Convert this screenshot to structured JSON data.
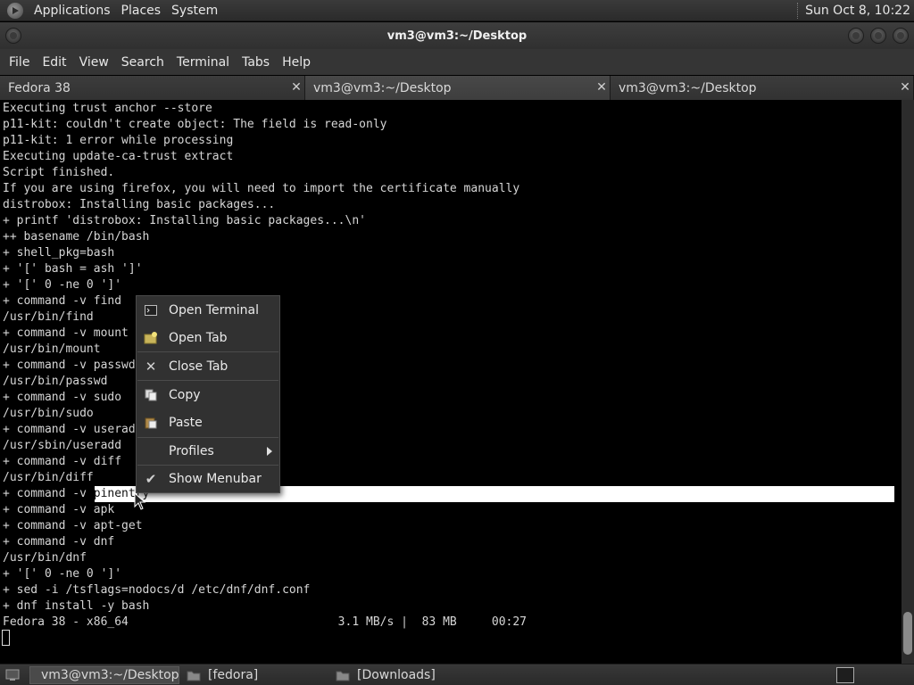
{
  "top_panel": {
    "menus": [
      "Applications",
      "Places",
      "System"
    ],
    "clock": "Sun Oct  8, 10:22"
  },
  "window": {
    "title": "vm3@vm3:~/Desktop"
  },
  "menubar": {
    "items": [
      "File",
      "Edit",
      "View",
      "Search",
      "Terminal",
      "Tabs",
      "Help"
    ]
  },
  "tabs": [
    {
      "label": "Fedora 38",
      "active": false
    },
    {
      "label": "vm3@vm3:~/Desktop",
      "active": true
    },
    {
      "label": "vm3@vm3:~/Desktop",
      "active": false
    }
  ],
  "terminal": {
    "lines": [
      "Executing trust anchor --store",
      "p11-kit: couldn't create object: The field is read-only",
      "p11-kit: 1 error while processing",
      "Executing update-ca-trust extract",
      "Script finished.",
      "If you are using firefox, you will need to import the certificate manually",
      "distrobox: Installing basic packages...",
      "+ printf 'distrobox: Installing basic packages...\\n'",
      "++ basename /bin/bash",
      "+ shell_pkg=bash",
      "+ '[' bash = ash ']'",
      "+ '[' 0 -ne 0 ']'",
      "+ command -v find",
      "/usr/bin/find",
      "+ command -v mount",
      "/usr/bin/mount",
      "+ command -v passwd",
      "/usr/bin/passwd",
      "+ command -v sudo",
      "/usr/bin/sudo",
      "+ command -v useradd",
      "/usr/sbin/useradd",
      "+ command -v diff",
      "/usr/bin/diff",
      "+ command -v ",
      "+ command -v apk",
      "+ command -v apt-get",
      "+ command -v dnf",
      "/usr/bin/dnf",
      "+ '[' 0 -ne 0 ']'",
      "+ sed -i /tsflags=nodocs/d /etc/dnf/dnf.conf",
      "+ dnf install -y bash",
      "Fedora 38 - x86_64                              3.1 MB/s |  83 MB     00:27"
    ],
    "selected_word": "pinentry"
  },
  "context_menu": {
    "items": [
      {
        "label": "Open Terminal",
        "icon": "terminal-icon"
      },
      {
        "label": "Open Tab",
        "icon": "new-tab-icon"
      },
      {
        "label": "Close Tab",
        "icon": "close-icon"
      },
      {
        "label": "Copy",
        "icon": "copy-icon"
      },
      {
        "label": "Paste",
        "icon": "paste-icon"
      },
      {
        "label": "Profiles",
        "icon": "",
        "submenu": true
      },
      {
        "label": "Show Menubar",
        "icon": "checkmark-icon",
        "checked": true
      }
    ]
  },
  "taskbar": {
    "items": [
      {
        "label": "vm3@vm3:~/Desktop",
        "active": true,
        "icon": "terminal-icon"
      },
      {
        "label": "[fedora]",
        "active": false,
        "icon": "folder-icon"
      },
      {
        "label": "[Downloads]",
        "active": false,
        "icon": "folder-icon"
      }
    ]
  },
  "colors": {
    "terminal_bg": "#000000",
    "terminal_fg": "#d6d6d6",
    "selection": "#ffffff",
    "panel": "#2f2f2f",
    "menu_bg": "#313131"
  }
}
